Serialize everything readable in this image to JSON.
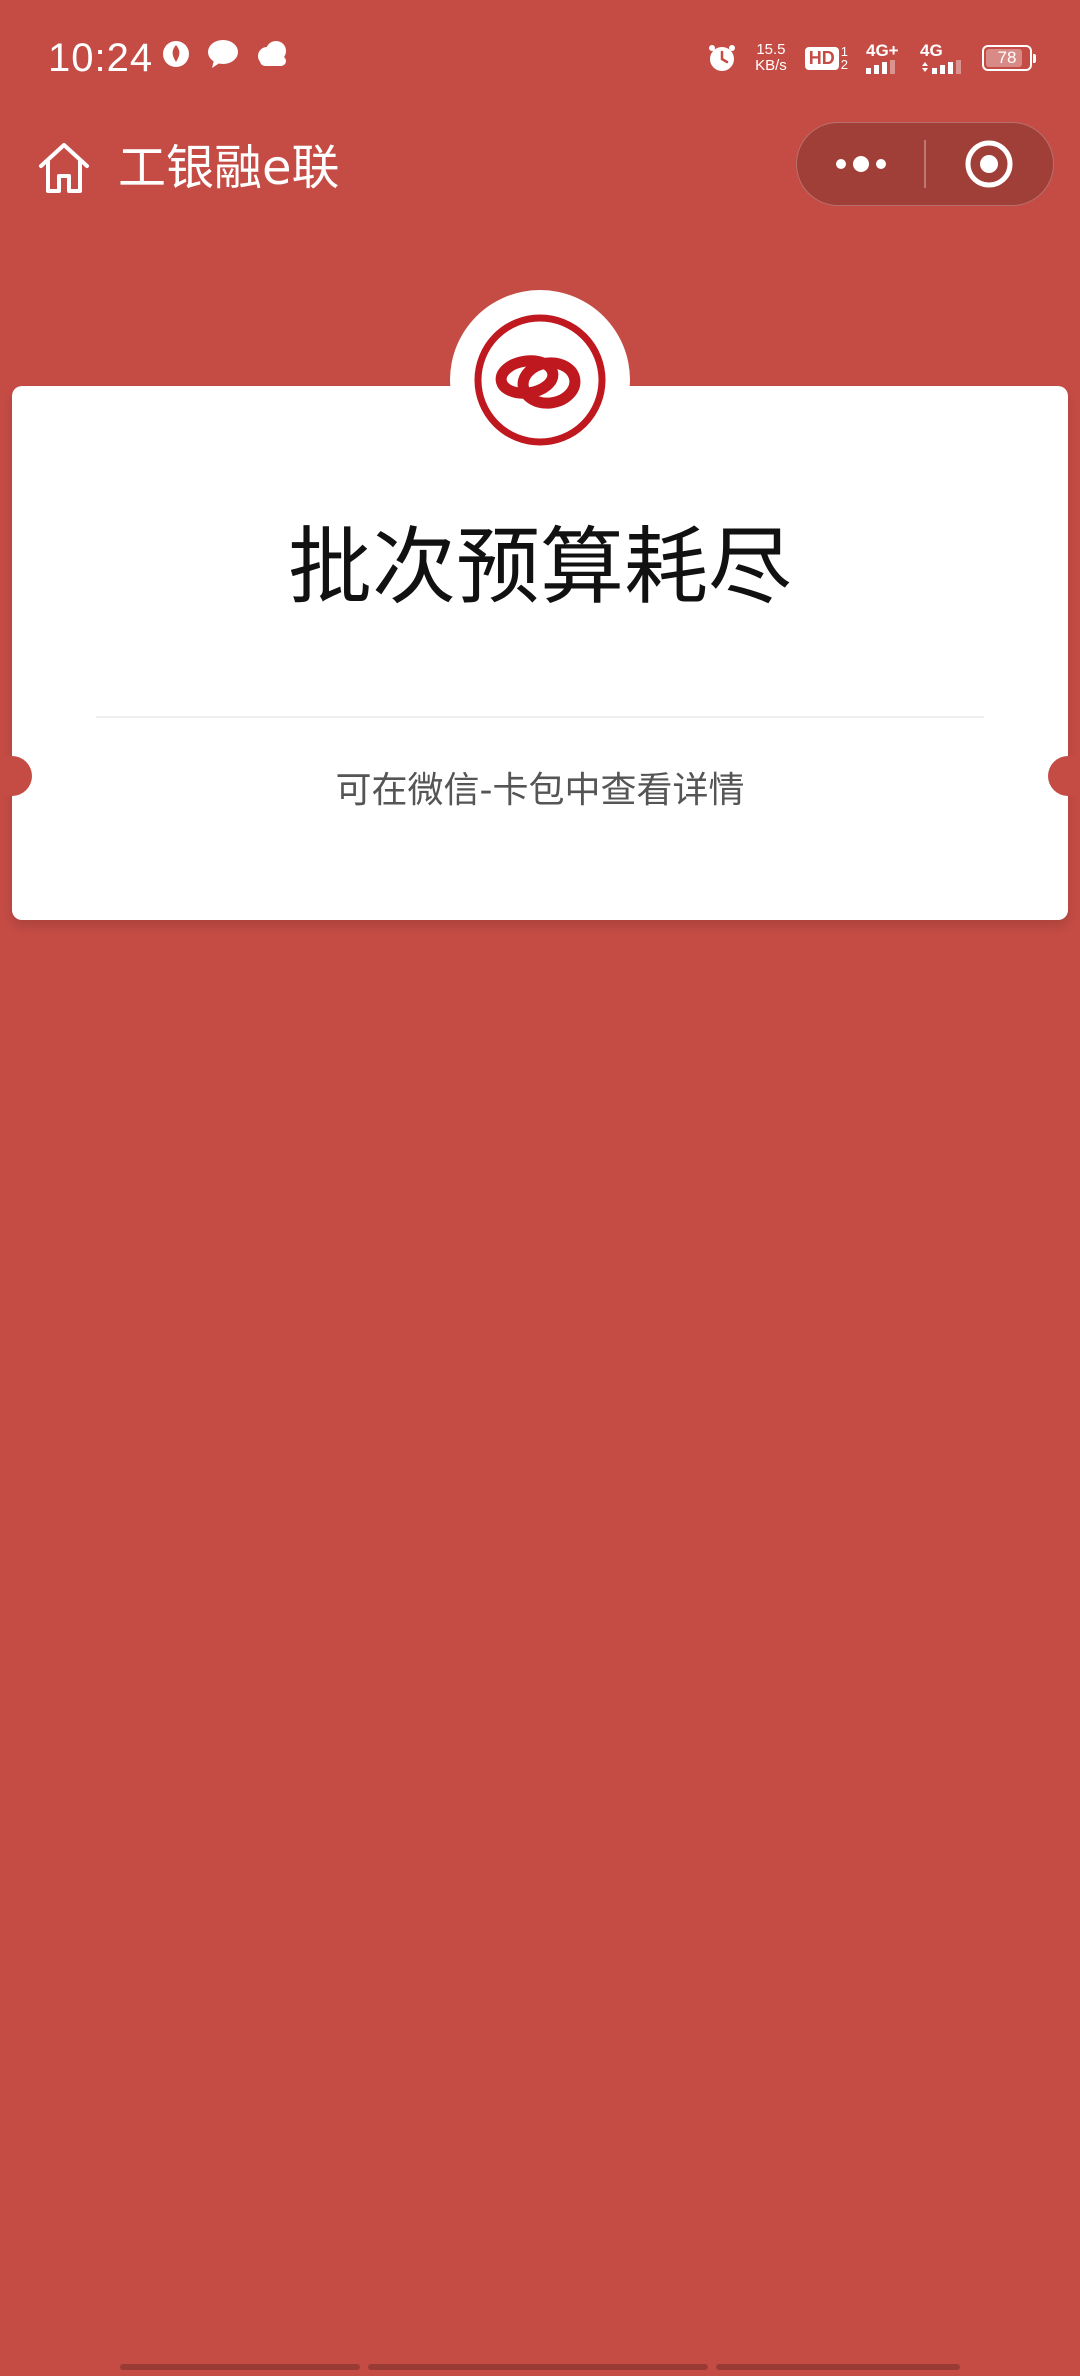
{
  "status_bar": {
    "time": "10:24",
    "left_icons": [
      "location-drop-icon",
      "chat-bubble-icon",
      "cloud-icon"
    ],
    "net_speed_value": "15.5",
    "net_speed_unit": "KB/s",
    "hd_label": "HD",
    "sim1_label": "4G+",
    "sim2_label": "4G",
    "battery_level": "78"
  },
  "nav": {
    "title": "工银融e联",
    "home_icon": "home-icon",
    "more_icon": "more-dots-icon",
    "close_icon": "target-circle-icon"
  },
  "card": {
    "logo_icon": "icbc-logo-icon",
    "title": "批次预算耗尽",
    "subtitle": "可在微信-卡包中查看详情"
  },
  "colors": {
    "background": "#c44c45",
    "card": "#ffffff",
    "brand_red": "#c0181f"
  }
}
